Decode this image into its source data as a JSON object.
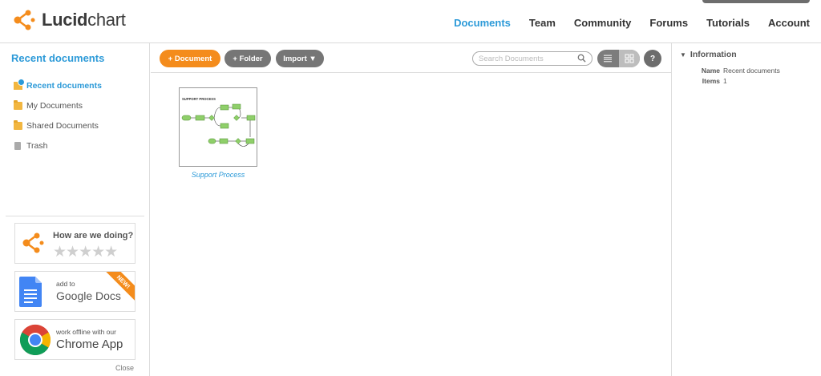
{
  "app": {
    "logo_bold": "Lucid",
    "logo_light": "chart",
    "brand_orange": "#f48c1c",
    "accent_blue": "#2c9ad8"
  },
  "nav": {
    "items": [
      {
        "label": "Documents",
        "active": true
      },
      {
        "label": "Team"
      },
      {
        "label": "Community"
      },
      {
        "label": "Forums"
      },
      {
        "label": "Tutorials"
      },
      {
        "label": "Account"
      }
    ]
  },
  "sidebar": {
    "title": "Recent documents",
    "items": [
      {
        "label": "Recent documents",
        "icon": "recent-folder-icon"
      },
      {
        "label": "My Documents",
        "icon": "folder-icon"
      },
      {
        "label": "Shared Documents",
        "icon": "folder-icon"
      },
      {
        "label": "Trash",
        "icon": "trash-icon"
      }
    ],
    "promo_rate": {
      "text": "How are we doing?",
      "stars": "★★★★★"
    },
    "promo_docs": {
      "small": "add to",
      "big": "Google Docs",
      "ribbon": "NEW!"
    },
    "promo_chrome": {
      "small": "work offline with our",
      "big": "Chrome App"
    },
    "close_label": "Close"
  },
  "toolbar": {
    "document_label": "+ Document",
    "folder_label": "+ Folder",
    "import_label": "Import ▼",
    "search_placeholder": "Search Documents",
    "help_label": "?"
  },
  "documents": [
    {
      "name": "Support Process",
      "thumb_title": "SUPPORT PROCESS"
    }
  ],
  "info": {
    "title": "Information",
    "name_key": "Name",
    "name_value": "Recent documents",
    "items_key": "Items",
    "items_value": "1"
  }
}
